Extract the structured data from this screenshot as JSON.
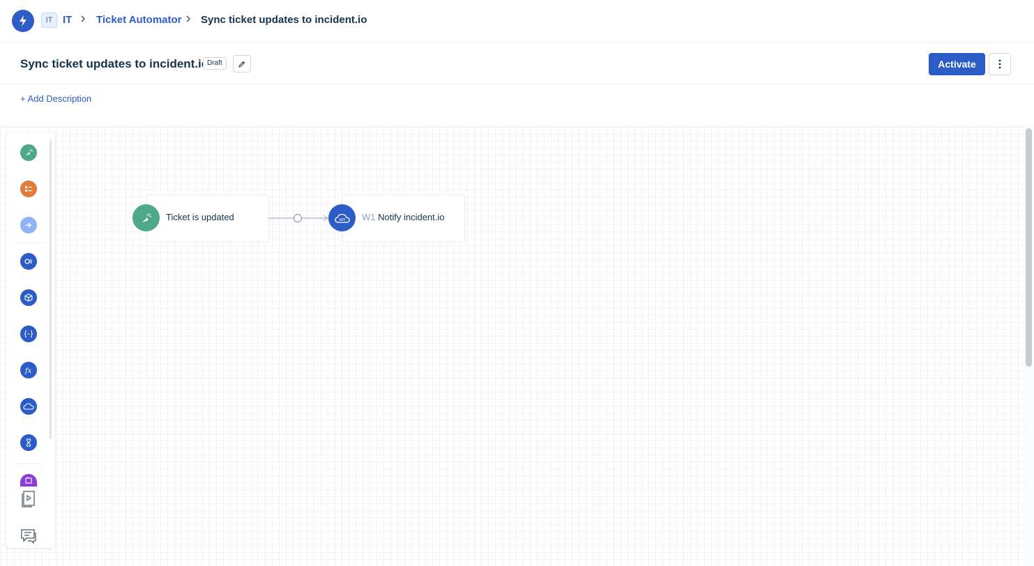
{
  "breadcrumb": {
    "workspace_badge": "IT",
    "workspace": "IT",
    "app": "Ticket Automator",
    "current": "Sync ticket updates to incident.io"
  },
  "header": {
    "title": "Sync ticket updates to incident.io",
    "status": "Draft",
    "activate_label": "Activate"
  },
  "add_description_label": "+ Add Description",
  "palette": {
    "items": [
      {
        "icon": "trigger-icon",
        "color": "#4ea98b"
      },
      {
        "icon": "condition-icon",
        "color": "#e07b39"
      },
      {
        "icon": "action-arrow-icon",
        "color": "#8fb4f5"
      },
      {
        "icon": "reader-icon",
        "color": "#2c5cc5"
      },
      {
        "icon": "app-icon",
        "color": "#2c5cc5"
      },
      {
        "icon": "expression-icon",
        "color": "#2c5cc5"
      },
      {
        "icon": "function-icon",
        "color": "#2c5cc5"
      },
      {
        "icon": "webhook-api-icon",
        "color": "#2c5cc5"
      },
      {
        "icon": "timer-icon",
        "color": "#2c5cc5"
      },
      {
        "icon": "orchestration-icon",
        "color": "#8b3dd6"
      }
    ],
    "bottom": [
      {
        "icon": "playbook-icon"
      },
      {
        "icon": "feedback-chat-icon"
      }
    ]
  },
  "workflow": {
    "trigger_node": {
      "label": "Ticket is updated",
      "color": "#4ea98b"
    },
    "action_node": {
      "prefix": "W1",
      "label": "Notify incident.io",
      "color": "#2c5cc5"
    }
  }
}
